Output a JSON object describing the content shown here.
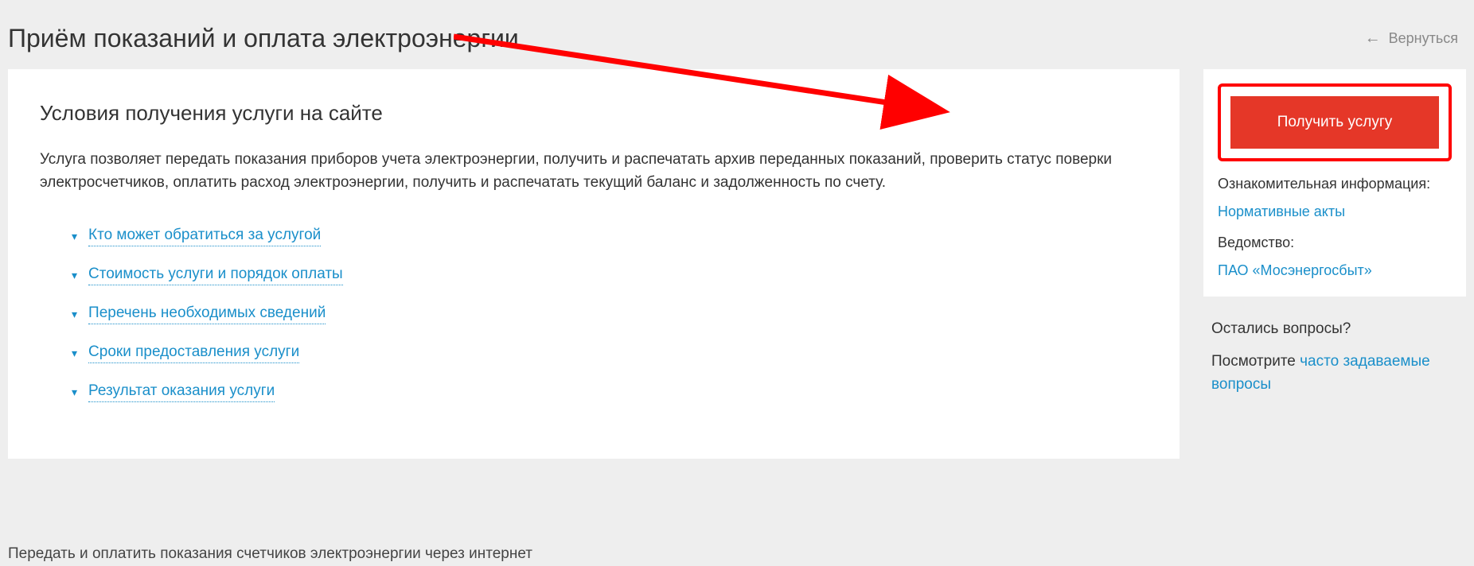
{
  "header": {
    "title": "Приём показаний и оплата электроэнергии",
    "back_label": "Вернуться"
  },
  "main": {
    "subtitle": "Условия получения услуги на сайте",
    "description": "Услуга позволяет передать показания приборов учета электроэнергии, получить и распечатать архив переданных показаний, проверить статус поверки электросчетчиков, оплатить расход электроэнергии, получить и распечатать текущий баланс и задолженность по счету.",
    "accordion": [
      "Кто может обратиться за услугой",
      "Стоимость услуги и порядок оплаты",
      "Перечень необходимых сведений",
      "Сроки предоставления услуги",
      "Результат оказания услуги"
    ]
  },
  "sidebar": {
    "cta_label": "Получить услугу",
    "info_label": "Ознакомительная информация:",
    "normative_link": "Нормативные акты",
    "agency_label": "Ведомство:",
    "agency_link": "ПАО «Мосэнергосбыт»",
    "questions_title": "Остались вопросы?",
    "questions_prefix": "Посмотрите ",
    "faq_link": "часто задаваемые вопросы"
  },
  "footer": {
    "caption": "Передать и оплатить показания счетчиков электроэнергии через интернет"
  }
}
